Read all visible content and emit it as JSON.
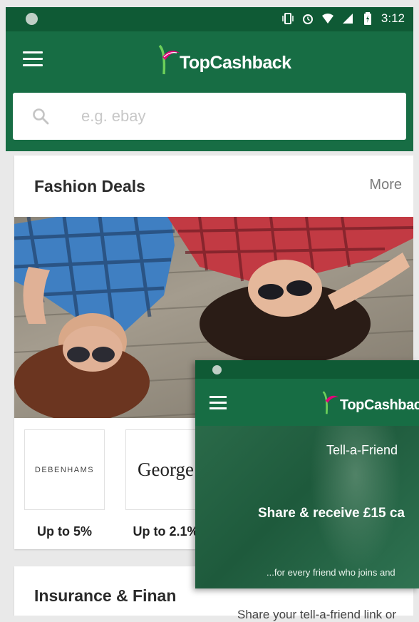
{
  "status_bar": {
    "time": "3:12"
  },
  "app": {
    "logo_text": "TopCashback"
  },
  "search": {
    "placeholder": "e.g. ebay"
  },
  "fashion": {
    "title": "Fashion Deals",
    "more_label": "More",
    "stores": [
      {
        "name": "DEBENHAMS",
        "rate": "Up to 5%"
      },
      {
        "name": "George",
        "rate": "Up to 2.1%"
      }
    ]
  },
  "insurance": {
    "title": "Insurance & Finan"
  },
  "below_text": "Share your tell-a-friend link or",
  "overlay": {
    "logo_text": "TopCashback",
    "tell_label": "Tell-a-Friend",
    "share_text": "Share & receive £15 ca",
    "friend_text": "...for every friend who joins and"
  },
  "colors": {
    "primary": "#176d44",
    "status": "#0f5a35",
    "accent": "#e2007a"
  }
}
